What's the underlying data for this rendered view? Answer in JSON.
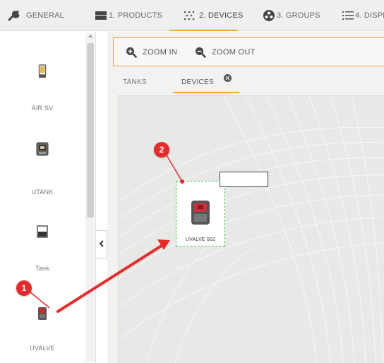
{
  "tabs": [
    {
      "label": "GENERAL",
      "icon": "wrench-icon"
    },
    {
      "label": "1. PRODUCTS",
      "icon": "box-icon"
    },
    {
      "label": "2. DEVICES",
      "icon": "dots-grid-icon",
      "active": true
    },
    {
      "label": "3. GROUPS",
      "icon": "groups-icon"
    },
    {
      "label": "4. DISPE",
      "icon": "list-icon"
    }
  ],
  "palette": {
    "items": [
      {
        "label": "AIR SV",
        "icon": "air-sv-icon"
      },
      {
        "label": "UTANK",
        "icon": "utank-icon"
      },
      {
        "label": "Tank",
        "icon": "tank-icon"
      },
      {
        "label": "UVALVE",
        "icon": "uvalve-icon"
      }
    ],
    "collapse_icon": "chevron-left-icon"
  },
  "toolbar": {
    "zoom_in": "ZOOM IN",
    "zoom_out": "ZOOM OUT"
  },
  "subtabs": {
    "tanks": "TANKS",
    "devices": "DEVICES"
  },
  "canvas": {
    "device_label": "UVALVE 002",
    "label_input_value": ""
  },
  "annotations": [
    {
      "number": "1"
    },
    {
      "number": "2"
    }
  ],
  "colors": {
    "accent": "#f0a24a",
    "annotation": "#e82a2a",
    "selection": "#3cc24a"
  }
}
